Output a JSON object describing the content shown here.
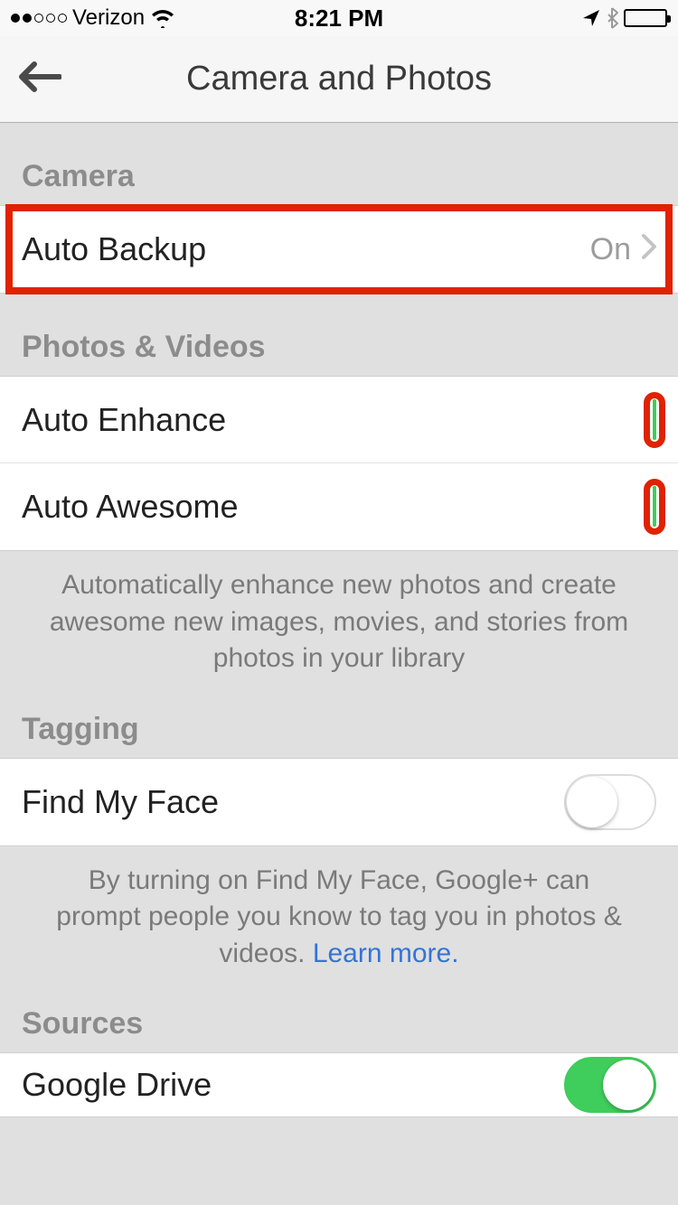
{
  "status_bar": {
    "carrier": "Verizon",
    "time": "8:21 PM"
  },
  "nav": {
    "title": "Camera and Photos"
  },
  "sections": {
    "camera": {
      "header": "Camera",
      "auto_backup": {
        "label": "Auto Backup",
        "value": "On"
      }
    },
    "photos_videos": {
      "header": "Photos & Videos",
      "auto_enhance": {
        "label": "Auto Enhance",
        "on": true
      },
      "auto_awesome": {
        "label": "Auto Awesome",
        "on": true
      },
      "footer": "Automatically enhance new photos and create awesome new images, movies, and stories from photos in your library"
    },
    "tagging": {
      "header": "Tagging",
      "find_my_face": {
        "label": "Find My Face",
        "on": false
      },
      "footer_pre": "By turning on Find My Face, Google+ can prompt people you know to tag you in photos & videos. ",
      "footer_link": "Learn more."
    },
    "sources": {
      "header": "Sources",
      "google_drive": {
        "label": "Google Drive",
        "on": true
      }
    }
  }
}
